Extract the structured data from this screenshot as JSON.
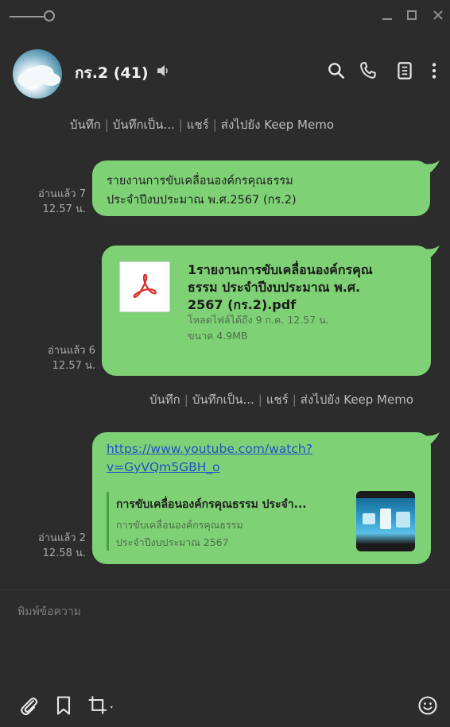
{
  "header": {
    "group_name": "กร.2 (41)"
  },
  "actions_row_1": [
    "บันทึก",
    "บันทึกเป็น...",
    "แชร์",
    "ส่งไปยัง Keep Memo"
  ],
  "actions_row_2": [
    "บันทึก",
    "บันทึกเป็น...",
    "แชร์",
    "ส่งไปยัง Keep Memo"
  ],
  "messages": [
    {
      "read": "อ่านแล้ว 7",
      "time": "12.57 น.",
      "text_line1": "รายงานการขับเคลื่อนองค์กรคุณธรรม",
      "text_line2": "ประจำปีงบประมาณ พ.ศ.2567 (กร.2)"
    },
    {
      "read": "อ่านแล้ว 6",
      "time": "12.57 น.",
      "file_name_line1": "1รายงานการขับเคลื่อนองค์กรคุณ",
      "file_name_line2": "ธรรม ประจำปีงบประมาณ พ.ศ.",
      "file_name_line3": "2567 (กร.2).pdf",
      "file_download": "โหลดไฟล์ได้ถึง 9 ก.ค. 12.57 น.",
      "file_size": "ขนาด 4.9MB"
    },
    {
      "read": "อ่านแล้ว 2",
      "time": "12.58 น.",
      "link_line1": "https://www.youtube.com/watch?",
      "link_line2": "v=GyVQm5GBH_o",
      "preview_title": "การขับเคลื่อนองค์กรคุณธรรม ประจำ...",
      "preview_desc_line1": "การขับเคลื่อนองค์กรคุณธรรม",
      "preview_desc_line2": "ประจำปีงบประมาณ 2567"
    }
  ],
  "composer": {
    "placeholder": "พิมพ์ข้อความ"
  },
  "colors": {
    "background": "#2c2c2c",
    "bubble": "#7fd176",
    "link": "#2450c8"
  }
}
